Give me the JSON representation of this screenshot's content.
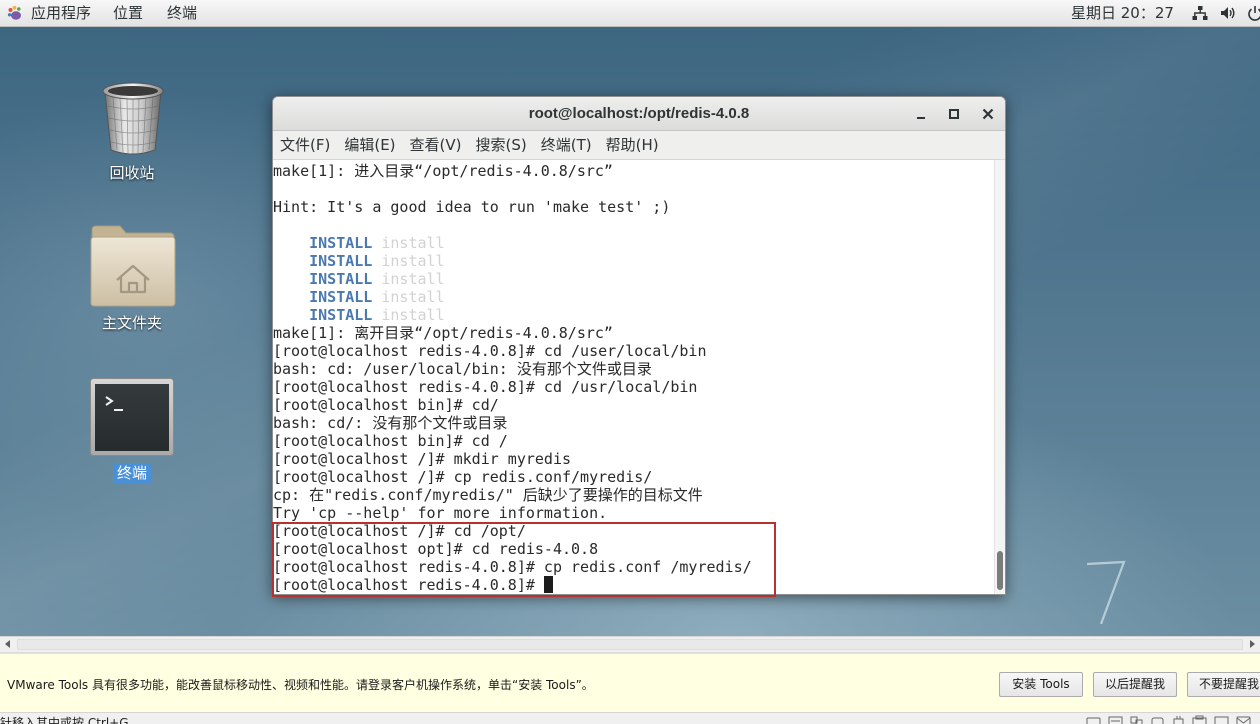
{
  "top_bar": {
    "applications": "应用程序",
    "places": "位置",
    "terminal_app": "终端",
    "clock": "星期日 20：27",
    "tray_icons": [
      "network-icon",
      "volume-icon",
      "power-icon"
    ]
  },
  "desktop": {
    "icons": [
      {
        "label": "回收站",
        "icon": "trash-icon"
      },
      {
        "label": "主文件夹",
        "icon": "home-folder-icon"
      },
      {
        "label": "终端",
        "icon": "terminal-icon",
        "selected": true
      }
    ],
    "wallpaper_logo": "7"
  },
  "terminal_window": {
    "title": "root@localhost:/opt/redis-4.0.8",
    "controls": [
      "minimize-icon",
      "maximize-icon",
      "close-icon"
    ],
    "menu": [
      "文件(F)",
      "编辑(E)",
      "查看(V)",
      "搜索(S)",
      "终端(T)",
      "帮助(H)"
    ],
    "lines": [
      {
        "segments": [
          {
            "text": "make[1]: 进入目录“/opt/redis-4.0.8/src”",
            "kind": "plain"
          }
        ]
      },
      {
        "segments": []
      },
      {
        "segments": [
          {
            "text": "Hint: It's a good idea to run 'make test' ;)",
            "kind": "plain"
          }
        ]
      },
      {
        "segments": []
      },
      {
        "segments": [
          {
            "text": "    ",
            "kind": "plain"
          },
          {
            "text": "INSTALL",
            "kind": "install-tag"
          },
          {
            "text": " ",
            "kind": "plain"
          },
          {
            "text": "install",
            "kind": "install-dim"
          }
        ]
      },
      {
        "segments": [
          {
            "text": "    ",
            "kind": "plain"
          },
          {
            "text": "INSTALL",
            "kind": "install-tag"
          },
          {
            "text": " ",
            "kind": "plain"
          },
          {
            "text": "install",
            "kind": "install-dim"
          }
        ]
      },
      {
        "segments": [
          {
            "text": "    ",
            "kind": "plain"
          },
          {
            "text": "INSTALL",
            "kind": "install-tag"
          },
          {
            "text": " ",
            "kind": "plain"
          },
          {
            "text": "install",
            "kind": "install-dim"
          }
        ]
      },
      {
        "segments": [
          {
            "text": "    ",
            "kind": "plain"
          },
          {
            "text": "INSTALL",
            "kind": "install-tag"
          },
          {
            "text": " ",
            "kind": "plain"
          },
          {
            "text": "install",
            "kind": "install-dim"
          }
        ]
      },
      {
        "segments": [
          {
            "text": "    ",
            "kind": "plain"
          },
          {
            "text": "INSTALL",
            "kind": "install-tag"
          },
          {
            "text": " ",
            "kind": "plain"
          },
          {
            "text": "install",
            "kind": "install-dim"
          }
        ]
      },
      {
        "segments": [
          {
            "text": "make[1]: 离开目录“/opt/redis-4.0.8/src”",
            "kind": "plain"
          }
        ]
      },
      {
        "segments": [
          {
            "text": "[root@localhost redis-4.0.8]# cd /user/local/bin",
            "kind": "plain"
          }
        ]
      },
      {
        "segments": [
          {
            "text": "bash: cd: /user/local/bin: 没有那个文件或目录",
            "kind": "plain"
          }
        ]
      },
      {
        "segments": [
          {
            "text": "[root@localhost redis-4.0.8]# cd /usr/local/bin",
            "kind": "plain"
          }
        ]
      },
      {
        "segments": [
          {
            "text": "[root@localhost bin]# cd/",
            "kind": "plain"
          }
        ]
      },
      {
        "segments": [
          {
            "text": "bash: cd/: 没有那个文件或目录",
            "kind": "plain"
          }
        ]
      },
      {
        "segments": [
          {
            "text": "[root@localhost bin]# cd /",
            "kind": "plain"
          }
        ]
      },
      {
        "segments": [
          {
            "text": "[root@localhost /]# mkdir myredis",
            "kind": "plain"
          }
        ]
      },
      {
        "segments": [
          {
            "text": "[root@localhost /]# cp redis.conf/myredis/",
            "kind": "plain"
          }
        ]
      },
      {
        "segments": [
          {
            "text": "cp: 在\"redis.conf/myredis/\" 后缺少了要操作的目标文件",
            "kind": "plain"
          }
        ]
      },
      {
        "segments": [
          {
            "text": "Try 'cp --help' for more information.",
            "kind": "plain"
          }
        ]
      },
      {
        "segments": [
          {
            "text": "[root@localhost /]# cd /opt/",
            "kind": "plain"
          }
        ]
      },
      {
        "segments": [
          {
            "text": "[root@localhost opt]# cd redis-4.0.8",
            "kind": "plain"
          }
        ]
      },
      {
        "segments": [
          {
            "text": "[root@localhost redis-4.0.8]# cp redis.conf /myredis/",
            "kind": "plain"
          }
        ]
      },
      {
        "segments": [
          {
            "text": "[root@localhost redis-4.0.8]# ",
            "kind": "plain"
          }
        ],
        "cursor": true
      }
    ],
    "highlight": {
      "first_line": 21,
      "last_line": 24,
      "color": "#b8312f"
    }
  },
  "vmware": {
    "tools_notice": "VMware Tools 具有很多功能，能改善鼠标移动性、视频和性能。请登录客户机操作系统，单击“安装 Tools”。",
    "buttons": [
      "安装 Tools",
      "以后提醒我",
      "不要提醒我"
    ],
    "notice_color": "#ffffe1",
    "status_text": "针移入其中或按 Ctrl+G",
    "status_icons": [
      "hard-disk-icon",
      "cd-drive-icon",
      "network-adapter-icon",
      "usb-controller-icon",
      "sound-card-icon",
      "printer-icon",
      "display-icon",
      "message-icon"
    ]
  }
}
